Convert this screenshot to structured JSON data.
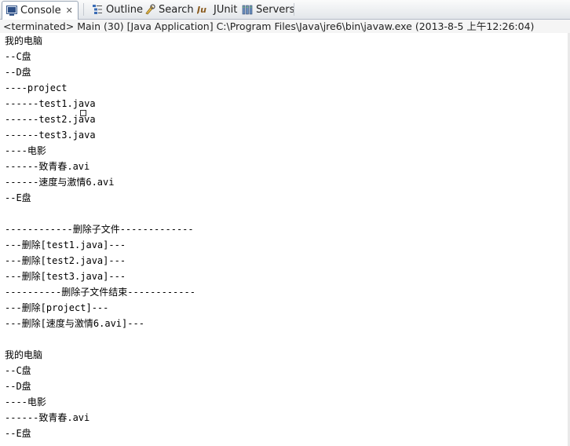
{
  "tabs": [
    {
      "label": "Console",
      "icon": "console-icon",
      "active": true,
      "closable": true
    },
    {
      "label": "Outline",
      "icon": "outline-icon"
    },
    {
      "label": "Search",
      "icon": "search-icon"
    },
    {
      "label": "JUnit",
      "icon": "junit-icon"
    },
    {
      "label": "Servers",
      "icon": "servers-icon"
    }
  ],
  "status": "<terminated> Main (30) [Java Application] C:\\Program Files\\Java\\jre6\\bin\\javaw.exe (2013-8-5 上午12:26:04)",
  "lines": [
    "我的电脑",
    "--C盘",
    "--D盘",
    "----project",
    "------test1.java",
    "------test2.java",
    "------test3.java",
    "----电影",
    "------致青春.avi",
    "------速度与激情6.avi",
    "--E盘",
    "",
    "------------删除子文件-------------",
    "---删除[test1.java]---",
    "---删除[test2.java]---",
    "---删除[test3.java]---",
    "----------删除子文件结束------------",
    "---删除[project]---",
    "---删除[速度与激情6.avi]---",
    "",
    "我的电脑",
    "--C盘",
    "--D盘",
    "----电影",
    "------致青春.avi",
    "--E盘"
  ]
}
